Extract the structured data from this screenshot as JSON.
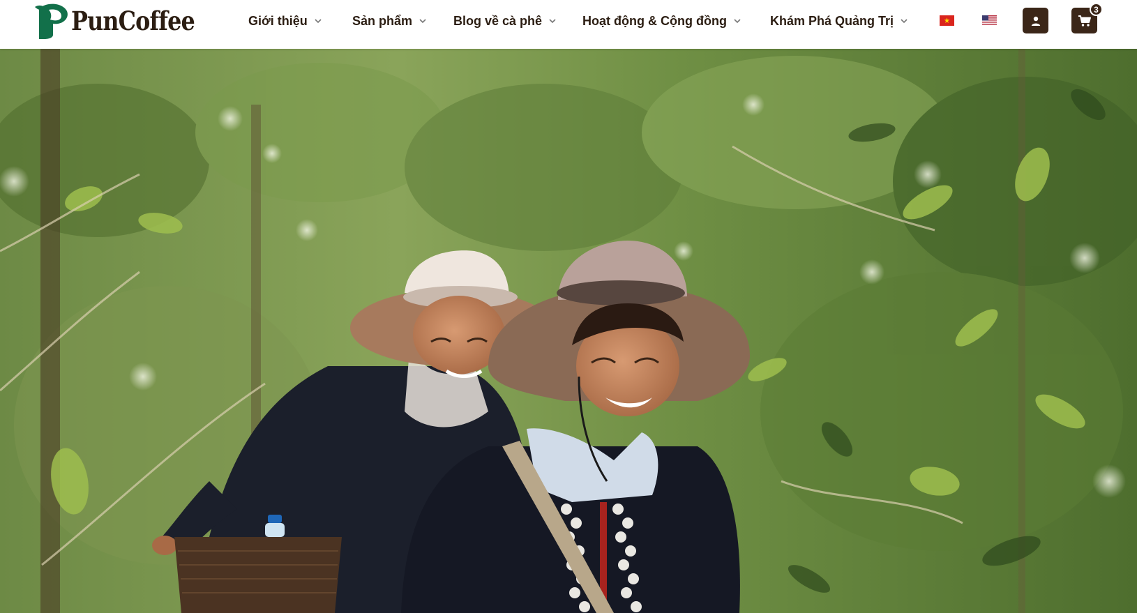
{
  "brand": {
    "name": "PunCoffee",
    "colors": {
      "brand_dark": "#3b2618",
      "logo_green": "#12704a",
      "text": "#2b1d12"
    }
  },
  "nav": {
    "items": [
      {
        "label": "Giới thiệu",
        "icon": "chevron-down-icon"
      },
      {
        "label": "Sản phẩm",
        "icon": "chevron-down-icon"
      },
      {
        "label": "Blog về cà phê",
        "icon": "chevron-down-icon"
      },
      {
        "label": "Hoạt động & Cộng đồng",
        "icon": "chevron-down-icon"
      },
      {
        "label": "Khám Phá Quảng Trị",
        "icon": "chevron-down-icon"
      }
    ]
  },
  "languages": [
    {
      "code": "vi",
      "icon": "vietnam-flag-icon"
    },
    {
      "code": "en",
      "icon": "us-flag-icon"
    }
  ],
  "account": {
    "icon": "user-icon"
  },
  "cart": {
    "icon": "cart-icon",
    "count": "3"
  },
  "hero": {
    "image": "photo-two-women-in-wide-brim-hats-walking-through-coffee-plantation"
  }
}
